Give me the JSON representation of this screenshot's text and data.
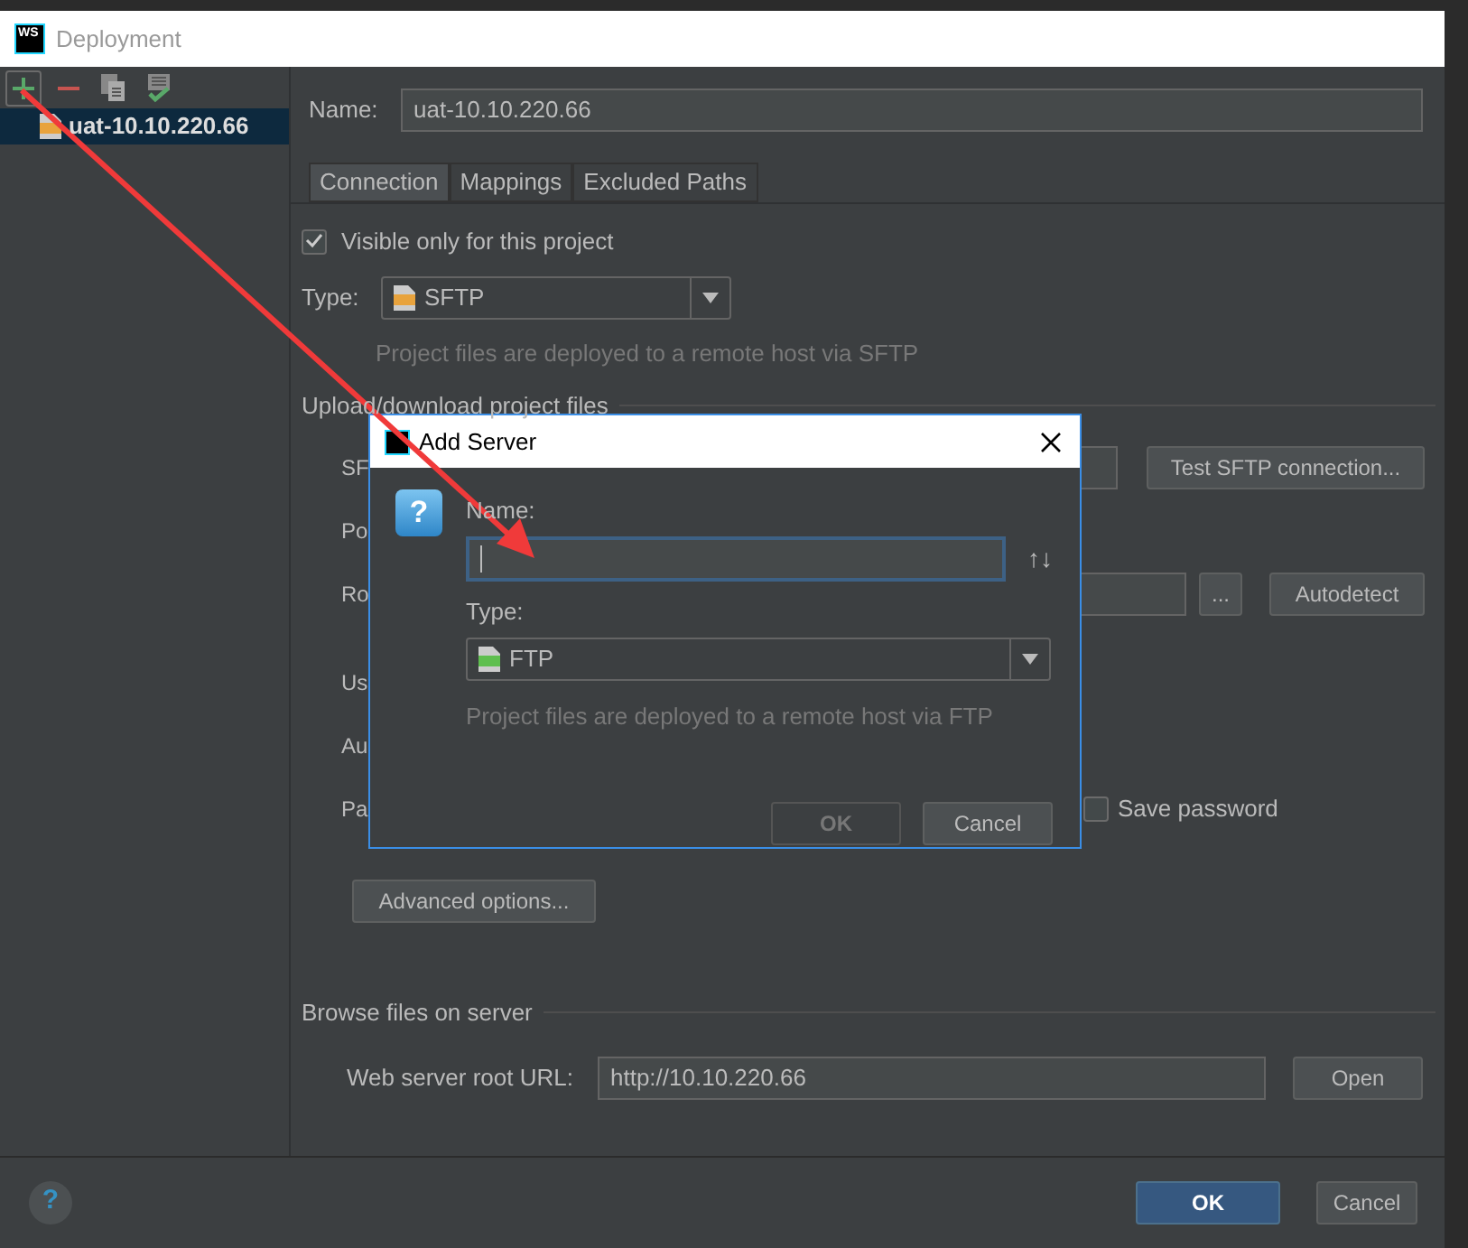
{
  "window": {
    "logo": "WS",
    "title": "Deployment"
  },
  "servers": [
    {
      "label": "uat-10.10.220.66",
      "selected": true
    }
  ],
  "name_field": {
    "label": "Name:",
    "value": "uat-10.10.220.66"
  },
  "tabs": [
    {
      "label": "Connection",
      "selected": true
    },
    {
      "label": "Mappings",
      "selected": false
    },
    {
      "label": "Excluded Paths",
      "selected": false
    }
  ],
  "visible_only": {
    "label": "Visible only for this project",
    "checked": true
  },
  "type_field": {
    "label": "Type:",
    "value": "SFTP",
    "hint": "Project files are deployed to a remote host via SFTP"
  },
  "upload_group": {
    "title": "Upload/download project files",
    "rows": [
      {
        "kind": "test",
        "label": "SF",
        "button": "Test SFTP connection..."
      },
      {
        "kind": "plain",
        "label": "Po"
      },
      {
        "kind": "browse",
        "label": "Ro",
        "browse": "...",
        "button": "Autodetect"
      },
      {
        "kind": "plain",
        "label": "Us"
      },
      {
        "kind": "plain",
        "label": "Au"
      },
      {
        "kind": "check",
        "label": "Pa",
        "check_label": "Save password",
        "checked": false
      }
    ]
  },
  "advanced_button": "Advanced options...",
  "browse_group": {
    "title": "Browse files on server",
    "label": "Web server root URL:",
    "value": "http://10.10.220.66",
    "button": "Open"
  },
  "help": "?",
  "footer_buttons": [
    {
      "label": "OK",
      "primary": true
    },
    {
      "label": "Cancel",
      "primary": false
    }
  ],
  "add_server_dialog": {
    "title": "Add Server",
    "icon_glyph": "?",
    "name_label": "Name:",
    "focused": true,
    "sort_glyph": "↑↓",
    "type_label": "Type:",
    "type_value": "FTP",
    "hint": "Project files are deployed to a remote host via FTP",
    "buttons": [
      {
        "label": "OK",
        "disabled": true
      },
      {
        "label": "Cancel",
        "disabled": false
      }
    ]
  }
}
